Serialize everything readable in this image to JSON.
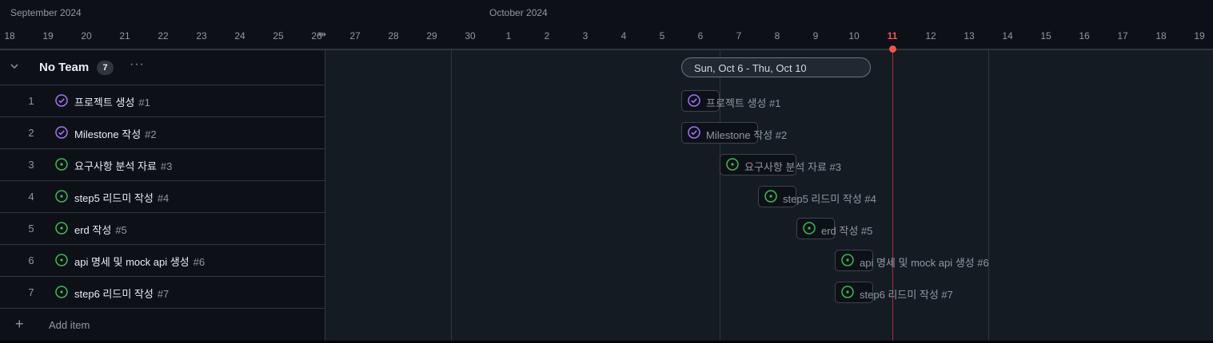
{
  "timeline": {
    "months": [
      {
        "label": "September 2024"
      },
      {
        "label": "October 2024"
      }
    ],
    "days": [
      "18",
      "19",
      "20",
      "21",
      "22",
      "23",
      "24",
      "25",
      "26",
      "27",
      "28",
      "29",
      "30",
      "1",
      "2",
      "3",
      "4",
      "5",
      "6",
      "7",
      "8",
      "9",
      "10",
      "11",
      "12",
      "13",
      "14",
      "15",
      "16",
      "17",
      "18",
      "19"
    ],
    "today_label": "11",
    "range_label": "Sun, Oct 6 - Thu, Oct 10"
  },
  "group": {
    "title": "No Team",
    "count": "7",
    "more": "···"
  },
  "items": [
    {
      "n": "1",
      "title": "프로젝트 생성",
      "num": "#1",
      "status": "done"
    },
    {
      "n": "2",
      "title": "Milestone 작성",
      "num": "#2",
      "status": "done"
    },
    {
      "n": "3",
      "title": "요구사항 분석 자료",
      "num": "#3",
      "status": "open"
    },
    {
      "n": "4",
      "title": "step5 리드미 작성",
      "num": "#4",
      "status": "open"
    },
    {
      "n": "5",
      "title": "erd 작성",
      "num": "#5",
      "status": "open"
    },
    {
      "n": "6",
      "title": "api 명세 및 mock api 생성",
      "num": "#6",
      "status": "open"
    },
    {
      "n": "7",
      "title": "step6 리드미 작성",
      "num": "#7",
      "status": "open"
    }
  ],
  "bar_labels": [
    "프로젝트 생성 #1",
    "Milestone 작성 #2",
    "요구사항 분석 자료 #3",
    "step5 리드미 작성 #4",
    "erd 작성 #5",
    "api 명세 및 mock api 생성 #6",
    "step6 리드미 작성 #7"
  ],
  "add_item": {
    "label": "Add item",
    "icon": "plus-icon"
  },
  "colors": {
    "done": "#a371f7",
    "open": "#3fb950",
    "today": "#f85149"
  }
}
